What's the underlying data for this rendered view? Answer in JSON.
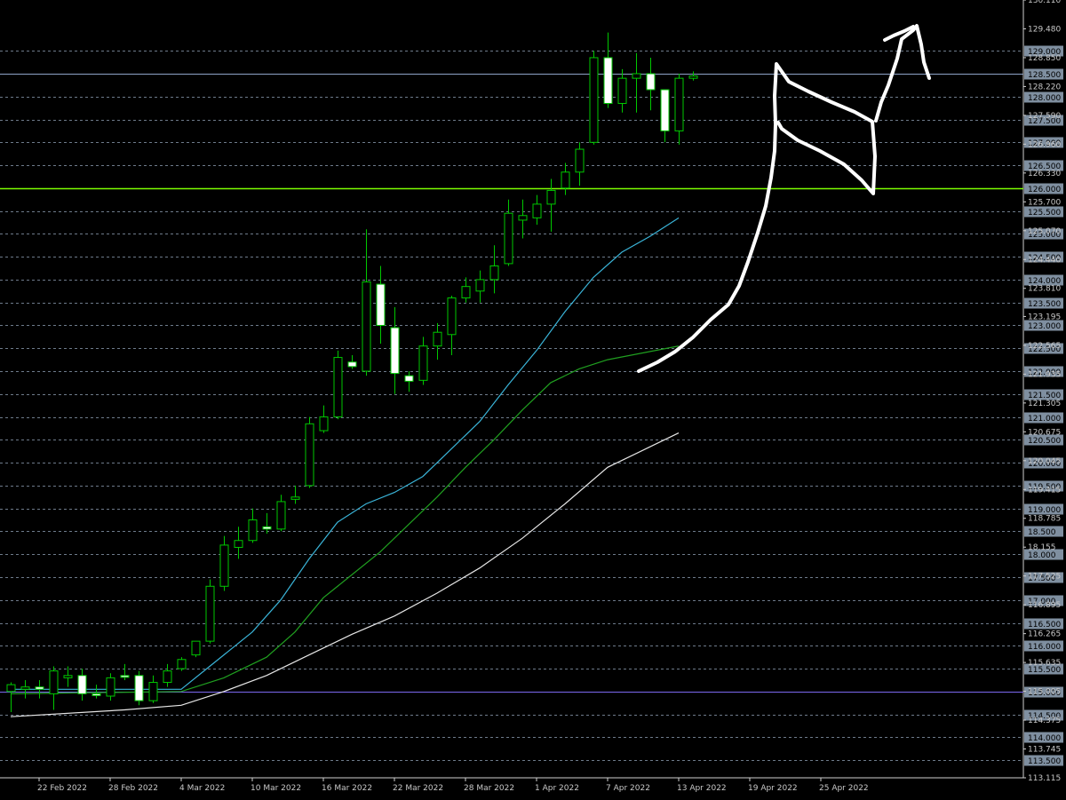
{
  "chart_data": {
    "type": "candlestick",
    "title": "",
    "colors": {
      "background": "#000000",
      "grid": "#6e7b8b",
      "candle_outline": "#00c800",
      "bull_body": "#000000",
      "bear_body": "#ffffff",
      "ma_fast": "#3ab4d8",
      "ma_mid": "#20a020",
      "ma_slow": "#e6e6e6",
      "level_126": "#7cfc00",
      "level_115": "#7b68ee",
      "level_128_5": "#8fa3c8",
      "drawing": "#ffffff"
    },
    "y_axis": {
      "range": [
        113.115,
        130.11
      ],
      "grid_levels": [
        "129.000",
        "128.500",
        "128.000",
        "127.500",
        "127.000",
        "126.500",
        "126.000",
        "125.500",
        "125.000",
        "124.500",
        "124.000",
        "123.500",
        "123.000",
        "122.500",
        "122.000",
        "121.500",
        "121.000",
        "120.500",
        "120.000",
        "119.500",
        "119.000",
        "18.500",
        "18.000",
        "17.500",
        "17.000",
        "116.500",
        "116.000",
        "115.500",
        "115.000",
        "114.500",
        "114.000",
        "113.500"
      ],
      "plain_ticks": [
        "130.110",
        "129.480",
        "128.850",
        "128.220",
        "127.590",
        "126.960",
        "126.330",
        "125.700",
        "125.070",
        "124.440",
        "123.810",
        "123.195",
        "122.565",
        "121.935",
        "121.305",
        "120.675",
        "120.045",
        "119.415",
        "118.785",
        "18.155",
        "117.525",
        "116.895",
        "116.265",
        "115.635",
        "115.005",
        "114.375",
        "113.745",
        "113.115"
      ]
    },
    "x_axis": {
      "labels": [
        "22 Feb 2022",
        "28 Feb 2022",
        "4 Mar 2022",
        "10 Mar 2022",
        "16 Mar 2022",
        "22 Mar 2022",
        "28 Mar 2022",
        "1 Apr 2022",
        "7 Apr 2022",
        "13 Apr 2022",
        "19 Apr 2022",
        "25 Apr 2022"
      ],
      "label_candle_index": [
        2,
        7,
        12,
        17,
        22,
        27,
        32,
        37,
        42,
        47,
        52,
        57
      ]
    },
    "horizontal_levels": [
      126.0,
      115.0,
      128.5
    ],
    "candles": [
      {
        "o": 115.0,
        "h": 115.2,
        "l": 114.55,
        "c": 115.15
      },
      {
        "o": 115.05,
        "h": 115.25,
        "l": 114.85,
        "c": 115.1
      },
      {
        "o": 115.1,
        "h": 115.25,
        "l": 114.85,
        "c": 115.05
      },
      {
        "o": 114.95,
        "h": 115.55,
        "l": 114.6,
        "c": 115.45
      },
      {
        "o": 115.3,
        "h": 115.55,
        "l": 115.1,
        "c": 115.35
      },
      {
        "o": 115.35,
        "h": 115.5,
        "l": 114.8,
        "c": 114.95
      },
      {
        "o": 114.95,
        "h": 115.15,
        "l": 114.85,
        "c": 114.92
      },
      {
        "o": 114.9,
        "h": 115.4,
        "l": 114.8,
        "c": 115.3
      },
      {
        "o": 115.35,
        "h": 115.6,
        "l": 115.25,
        "c": 115.32
      },
      {
        "o": 115.35,
        "h": 115.45,
        "l": 114.7,
        "c": 114.8
      },
      {
        "o": 114.8,
        "h": 115.35,
        "l": 114.75,
        "c": 115.2
      },
      {
        "o": 115.2,
        "h": 115.6,
        "l": 115.1,
        "c": 115.45
      },
      {
        "o": 115.5,
        "h": 115.75,
        "l": 115.45,
        "c": 115.7
      },
      {
        "o": 115.8,
        "h": 116.0,
        "l": 115.75,
        "c": 116.1
      },
      {
        "o": 116.1,
        "h": 117.45,
        "l": 116.05,
        "c": 117.3
      },
      {
        "o": 117.3,
        "h": 118.4,
        "l": 117.2,
        "c": 118.2
      },
      {
        "o": 118.15,
        "h": 118.6,
        "l": 117.9,
        "c": 118.3
      },
      {
        "o": 118.3,
        "h": 119.0,
        "l": 118.25,
        "c": 118.75
      },
      {
        "o": 118.6,
        "h": 118.9,
        "l": 118.45,
        "c": 118.55
      },
      {
        "o": 118.55,
        "h": 119.3,
        "l": 118.5,
        "c": 119.15
      },
      {
        "o": 119.2,
        "h": 119.5,
        "l": 119.1,
        "c": 119.25
      },
      {
        "o": 119.5,
        "h": 121.0,
        "l": 119.45,
        "c": 120.85
      },
      {
        "o": 120.7,
        "h": 121.25,
        "l": 120.65,
        "c": 121.0
      },
      {
        "o": 121.0,
        "h": 122.45,
        "l": 120.95,
        "c": 122.3
      },
      {
        "o": 122.2,
        "h": 122.35,
        "l": 122.05,
        "c": 122.1
      },
      {
        "o": 122.0,
        "h": 125.1,
        "l": 121.9,
        "c": 123.95
      },
      {
        "o": 123.9,
        "h": 124.3,
        "l": 122.6,
        "c": 123.0
      },
      {
        "o": 122.95,
        "h": 123.4,
        "l": 121.5,
        "c": 121.95
      },
      {
        "o": 121.9,
        "h": 122.0,
        "l": 121.55,
        "c": 121.78
      },
      {
        "o": 121.8,
        "h": 122.75,
        "l": 121.7,
        "c": 122.55
      },
      {
        "o": 122.55,
        "h": 123.05,
        "l": 122.25,
        "c": 122.85
      },
      {
        "o": 122.8,
        "h": 123.65,
        "l": 122.35,
        "c": 123.6
      },
      {
        "o": 123.6,
        "h": 124.05,
        "l": 123.5,
        "c": 123.85
      },
      {
        "o": 123.75,
        "h": 124.2,
        "l": 123.5,
        "c": 124.0
      },
      {
        "o": 124.0,
        "h": 124.75,
        "l": 123.7,
        "c": 124.3
      },
      {
        "o": 124.35,
        "h": 125.75,
        "l": 124.3,
        "c": 125.45
      },
      {
        "o": 125.3,
        "h": 125.75,
        "l": 124.9,
        "c": 125.4
      },
      {
        "o": 125.35,
        "h": 125.85,
        "l": 125.2,
        "c": 125.65
      },
      {
        "o": 125.65,
        "h": 126.2,
        "l": 125.05,
        "c": 125.95
      },
      {
        "o": 126.0,
        "h": 126.55,
        "l": 125.85,
        "c": 126.35
      },
      {
        "o": 126.35,
        "h": 127.0,
        "l": 126.05,
        "c": 126.85
      },
      {
        "o": 127.0,
        "h": 129.0,
        "l": 126.95,
        "c": 128.85
      },
      {
        "o": 128.85,
        "h": 129.4,
        "l": 127.75,
        "c": 127.85
      },
      {
        "o": 127.85,
        "h": 128.6,
        "l": 127.65,
        "c": 128.4
      },
      {
        "o": 128.4,
        "h": 128.95,
        "l": 127.65,
        "c": 128.5
      },
      {
        "o": 128.5,
        "h": 128.85,
        "l": 127.7,
        "c": 128.15
      },
      {
        "o": 128.15,
        "h": 128.15,
        "l": 127.0,
        "c": 127.25
      },
      {
        "o": 127.25,
        "h": 128.5,
        "l": 126.95,
        "c": 128.4
      },
      {
        "o": 128.4,
        "h": 128.55,
        "l": 128.35,
        "c": 128.45
      }
    ],
    "moving_averages": [
      {
        "key": "ma_fast",
        "points": [
          [
            0,
            115.05
          ],
          [
            12,
            115.05
          ],
          [
            14,
            115.55
          ],
          [
            17,
            116.3
          ],
          [
            19,
            117.0
          ],
          [
            21,
            117.9
          ],
          [
            23,
            118.7
          ],
          [
            25,
            119.1
          ],
          [
            27,
            119.35
          ],
          [
            29,
            119.7
          ],
          [
            31,
            120.3
          ],
          [
            33,
            120.9
          ],
          [
            35,
            121.7
          ],
          [
            37,
            122.45
          ],
          [
            39,
            123.3
          ],
          [
            41,
            124.05
          ],
          [
            43,
            124.6
          ],
          [
            45,
            124.95
          ],
          [
            47,
            125.35
          ]
        ]
      },
      {
        "key": "ma_mid",
        "points": [
          [
            0,
            114.95
          ],
          [
            12,
            115.0
          ],
          [
            15,
            115.3
          ],
          [
            18,
            115.75
          ],
          [
            20,
            116.3
          ],
          [
            22,
            117.05
          ],
          [
            24,
            117.55
          ],
          [
            26,
            118.05
          ],
          [
            28,
            118.65
          ],
          [
            30,
            119.25
          ],
          [
            32,
            119.9
          ],
          [
            34,
            120.5
          ],
          [
            36,
            121.15
          ],
          [
            38,
            121.75
          ],
          [
            40,
            122.05
          ],
          [
            42,
            122.25
          ],
          [
            47,
            122.55
          ]
        ]
      },
      {
        "key": "ma_slow",
        "points": [
          [
            0,
            114.45
          ],
          [
            8,
            114.6
          ],
          [
            12,
            114.7
          ],
          [
            15,
            115.0
          ],
          [
            18,
            115.35
          ],
          [
            21,
            115.8
          ],
          [
            24,
            116.25
          ],
          [
            27,
            116.65
          ],
          [
            30,
            117.15
          ],
          [
            33,
            117.7
          ],
          [
            36,
            118.35
          ],
          [
            39,
            119.1
          ],
          [
            42,
            119.9
          ],
          [
            45,
            120.35
          ],
          [
            47,
            120.65
          ]
        ]
      }
    ],
    "annotation_strokes": [
      [
        [
          719,
          418
        ],
        [
          740,
          408
        ],
        [
          760,
          396
        ],
        [
          780,
          380
        ],
        [
          800,
          360
        ],
        [
          820,
          343
        ],
        [
          832,
          322
        ],
        [
          842,
          295
        ],
        [
          853,
          262
        ],
        [
          862,
          232
        ],
        [
          868,
          200
        ],
        [
          872,
          170
        ],
        [
          873,
          140
        ],
        [
          872,
          108
        ],
        [
          874,
          72
        ],
        [
          888,
          92
        ],
        [
          910,
          103
        ],
        [
          936,
          115
        ],
        [
          962,
          126
        ],
        [
          982,
          137
        ],
        [
          985,
          176
        ],
        [
          983,
          218
        ],
        [
          970,
          203
        ],
        [
          950,
          185
        ],
        [
          923,
          170
        ],
        [
          898,
          158
        ],
        [
          880,
          145
        ],
        [
          876,
          138
        ]
      ],
      [
        [
          986,
          136
        ],
        [
          992,
          115
        ],
        [
          1000,
          96
        ],
        [
          1010,
          66
        ],
        [
          1015,
          44
        ],
        [
          1028,
          34
        ],
        [
          1032,
          29
        ],
        [
          1037,
          50
        ],
        [
          1040,
          70
        ],
        [
          1046,
          88
        ]
      ],
      [
        [
          996,
          45
        ],
        [
          1006,
          40
        ],
        [
          1018,
          35
        ],
        [
          1028,
          30
        ]
      ]
    ]
  }
}
